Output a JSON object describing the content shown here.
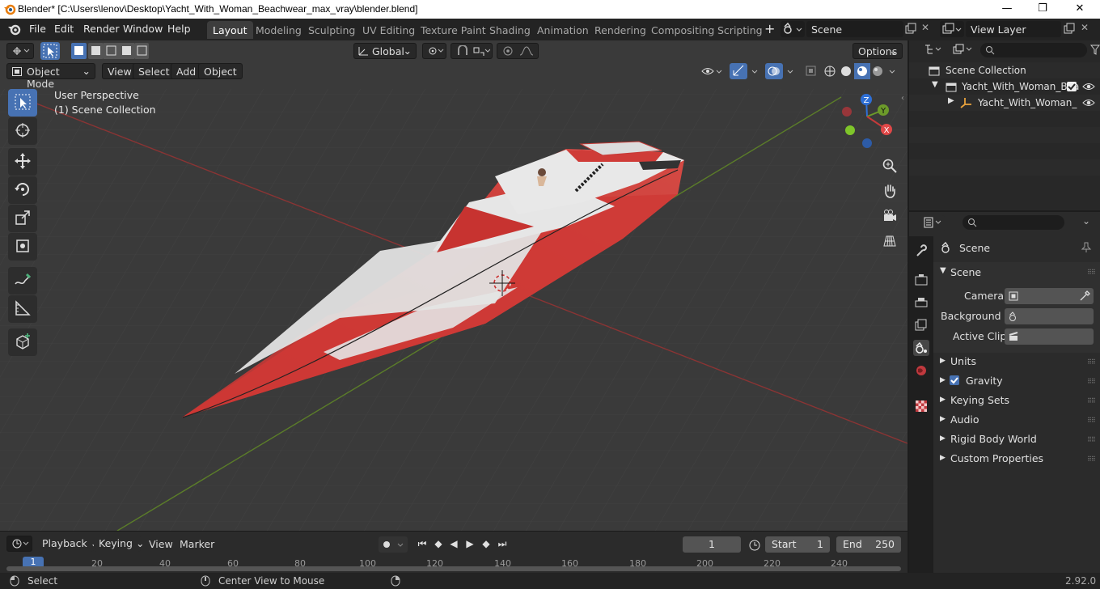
{
  "window": {
    "title": "Blender* [C:\\Users\\lenov\\Desktop\\Yacht_With_Woman_Beachwear_max_vray\\blender.blend]",
    "minimize": "—",
    "maximize": "❐",
    "close": "✕"
  },
  "topbar": {
    "menus": [
      "File",
      "Edit",
      "Render",
      "Window",
      "Help"
    ],
    "workspaces": [
      "Layout",
      "Modeling",
      "Sculpting",
      "UV Editing",
      "Texture Paint",
      "Shading",
      "Animation",
      "Rendering",
      "Compositing",
      "Scripting"
    ],
    "active_workspace": "Layout",
    "add_tab": "+",
    "scene_name": "Scene",
    "view_layer": "View Layer"
  },
  "viewport": {
    "transform_orientation": "Global",
    "options": "Options",
    "mode": "Object Mode",
    "menus": [
      "View",
      "Select",
      "Add",
      "Object"
    ],
    "overlay_title": "User Perspective",
    "overlay_subtitle": "(1) Scene Collection",
    "gizmo": {
      "x": "X",
      "y": "Y",
      "z": "Z"
    },
    "colors": {
      "background": "#3a3a3a",
      "x_axis": "#c43a3a",
      "y_axis": "#6c9a2a",
      "z_axis": "#2e6fd6",
      "hull_red": "#c8302f",
      "hull_white": "#e4e4e4"
    }
  },
  "tools": [
    "select-box",
    "cursor",
    "move",
    "rotate",
    "scale",
    "transform",
    "annotate",
    "measure",
    "add-cube"
  ],
  "timeline": {
    "menus": [
      "Playback",
      "Keying",
      "View",
      "Marker"
    ],
    "current_frame": "1",
    "start_label": "Start",
    "start_value": "1",
    "end_label": "End",
    "end_value": "250",
    "ticks": [
      "20",
      "40",
      "60",
      "80",
      "100",
      "120",
      "140",
      "160",
      "180",
      "200",
      "220",
      "240"
    ],
    "playhead_frame": "1"
  },
  "statusbar": {
    "left": "Select",
    "middle": "Center View to Mouse",
    "version": "2.92.0"
  },
  "outliner": {
    "root": "Scene Collection",
    "collection": "Yacht_With_Woman_Bea",
    "object": "Yacht_With_Woman_"
  },
  "properties": {
    "context": "Scene",
    "panel": "Scene",
    "camera_label": "Camera",
    "background_label": "Background ...",
    "active_clip_label": "Active Clip",
    "sections": [
      "Units",
      "Gravity",
      "Keying Sets",
      "Audio",
      "Rigid Body World",
      "Custom Properties"
    ],
    "gravity_checked": true
  }
}
